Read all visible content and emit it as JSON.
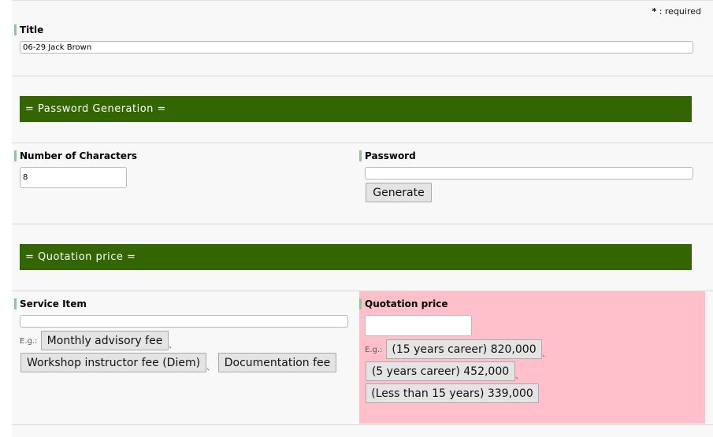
{
  "required_note": {
    "star": "*",
    "text": ": required"
  },
  "title_field": {
    "label": "Title",
    "value": "06-29 Jack Brown"
  },
  "password_section": {
    "heading": "= Password Generation =",
    "num_chars_label": "Number of Characters",
    "num_chars_value": "8",
    "password_label": "Password",
    "password_value": "",
    "generate_label": "Generate"
  },
  "quotation_section": {
    "heading": "= Quotation price =",
    "service_item_label": "Service Item",
    "service_item_value": "",
    "eg_label": "E.g.:",
    "separator": "、",
    "service_examples": [
      "Monthly advisory fee",
      "Workshop instructor fee (Diem)",
      "Documentation fee"
    ],
    "quotation_label": "Quotation price",
    "quotation_value": "",
    "price_examples": [
      "(15 years career) 820,000",
      "(5 years career) 452,000",
      "(Less than 15 years) 339,000"
    ],
    "highlight_color": "#ffc0cb"
  },
  "colors": {
    "section_bar": "#336600",
    "label_accent": "#8fc59a"
  }
}
